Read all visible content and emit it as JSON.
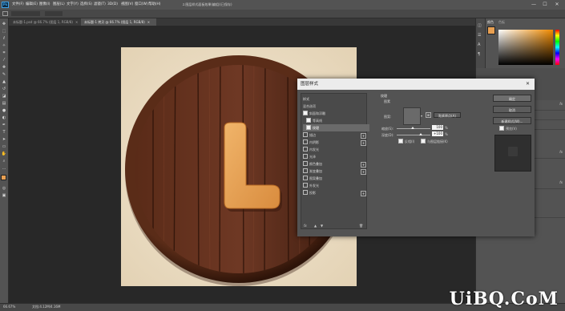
{
  "app": {
    "logo": "Ps",
    "menu": [
      "文件(F)",
      "编辑(E)",
      "图像(I)",
      "图层(L)",
      "文字(Y)",
      "选择(S)",
      "滤镜(T)",
      "3D(D)",
      "视图(V)",
      "窗口(W)",
      "帮助(H)"
    ],
    "window_title": "z.图层样式面板效果(编组)(已保存) ",
    "window_controls": [
      "—",
      "☐",
      "✕"
    ]
  },
  "document_tabs": [
    {
      "label": "未标题-1.psd @ 66.7% (图层 1, RGB/8)",
      "close": "×",
      "active": false
    },
    {
      "label": "未标题-1 拷贝 @ 66.7% (图层 1, RGB/8)",
      "close": "×",
      "active": true
    }
  ],
  "canvas": {
    "letter": "L",
    "colors": {
      "wood_dark": "#3d1f12",
      "wood_mid": "#6b3522",
      "rim": "#4a2414",
      "letter": "#e8a358",
      "bg": "#efe3cd"
    }
  },
  "dialog": {
    "title": "图层样式",
    "close": "✕",
    "styles_header": "样式",
    "styles": [
      {
        "label": "混合选项",
        "checkbox": false,
        "plus": false
      },
      {
        "label": "斜面和浮雕",
        "checkbox": true,
        "checked": true,
        "plus": false
      },
      {
        "label": "等高线",
        "checkbox": true,
        "checked": true,
        "plus": false
      },
      {
        "label": "纹理",
        "checkbox": true,
        "checked": true,
        "plus": false
      },
      {
        "label": "描边",
        "checkbox": true,
        "checked": false,
        "plus": true
      },
      {
        "label": "内阴影",
        "checkbox": true,
        "checked": false,
        "plus": true
      },
      {
        "label": "内发光",
        "checkbox": true,
        "checked": false,
        "plus": false
      },
      {
        "label": "光泽",
        "checkbox": true,
        "checked": false,
        "plus": false
      },
      {
        "label": "颜色叠加",
        "checkbox": true,
        "checked": false,
        "plus": true
      },
      {
        "label": "渐变叠加",
        "checkbox": true,
        "checked": false,
        "plus": true
      },
      {
        "label": "图案叠加",
        "checkbox": true,
        "checked": false,
        "plus": false
      },
      {
        "label": "外发光",
        "checkbox": true,
        "checked": false,
        "plus": false
      },
      {
        "label": "投影",
        "checkbox": true,
        "checked": false,
        "plus": true
      }
    ],
    "fx_label": "fx",
    "section_title": "纹理",
    "section_sub": "图素",
    "pattern_label": "图案:",
    "snap_button": "贴紧原点(A)",
    "scale_label": "缩放(S):",
    "scale_value": "100",
    "scale_unit": "%",
    "depth_label": "深度(D):",
    "depth_value": "+100",
    "depth_unit": "%",
    "invert_label": "反相(I)",
    "link_label": "与图层链接(K)",
    "buttons": {
      "ok": "确定",
      "cancel": "取消",
      "new_style": "新建样式(W)...",
      "preview": "预览(V)"
    }
  },
  "right_panel": {
    "tabs": [
      "颜色",
      "色板"
    ],
    "accent": "#e8a052"
  },
  "statusbar": {
    "zoom": "66.67%",
    "doc_info": "文档:4.12M/4.16M"
  },
  "watermark": "UiBQ.CoM"
}
